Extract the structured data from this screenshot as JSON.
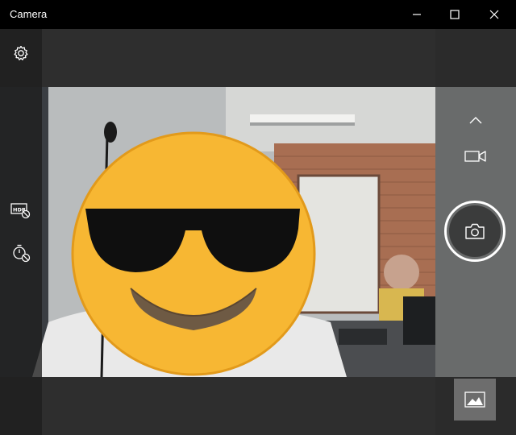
{
  "window": {
    "title": "Camera"
  },
  "icons": {
    "minimize": "minimize-icon",
    "maximize": "maximize-icon",
    "close": "close-icon",
    "settings": "gear-icon",
    "hdr": "hdr-off-icon",
    "timer": "timer-off-icon",
    "chevron": "chevron-up-icon",
    "video": "video-camera-icon",
    "photo": "camera-icon",
    "gallery": "gallery-thumbnail-icon"
  },
  "colors": {
    "titlebar": "#000000",
    "panel": "#2b2b2b",
    "accent_face_box": "#1fb5c9",
    "emoji_yellow": "#f7b733"
  }
}
